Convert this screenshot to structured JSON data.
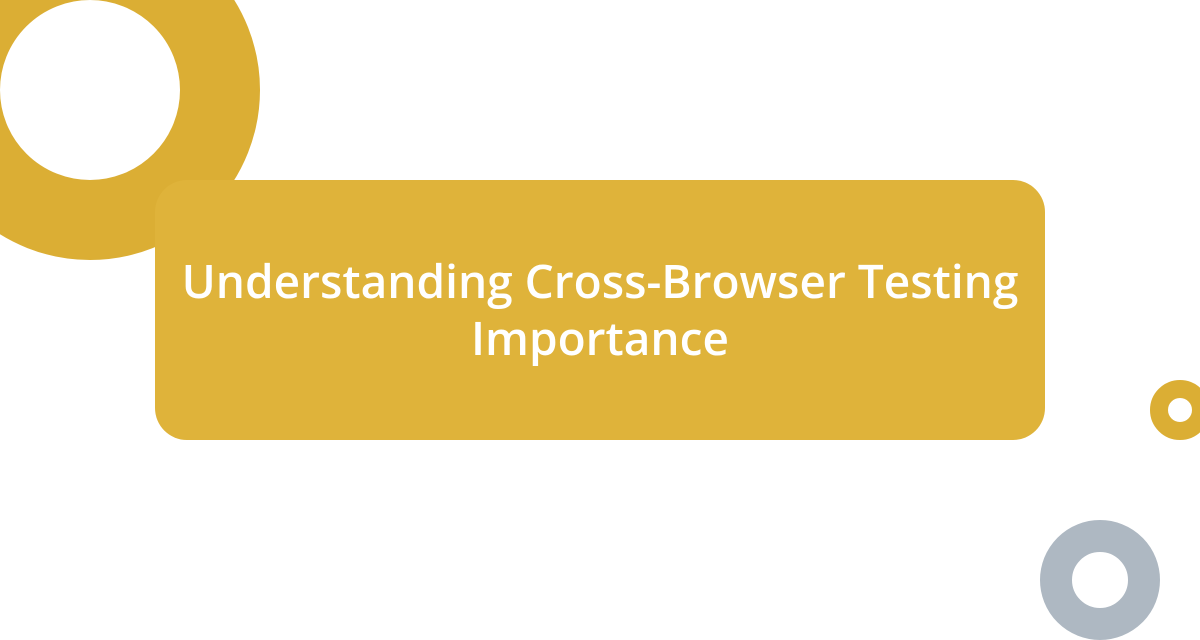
{
  "title": "Understanding Cross-Browser Testing Importance",
  "colors": {
    "accent_gold": "#dfb33a",
    "accent_gold_dark": "#dbae34",
    "accent_gray": "#aeb8c2",
    "text": "#ffffff",
    "background": "#ffffff"
  }
}
